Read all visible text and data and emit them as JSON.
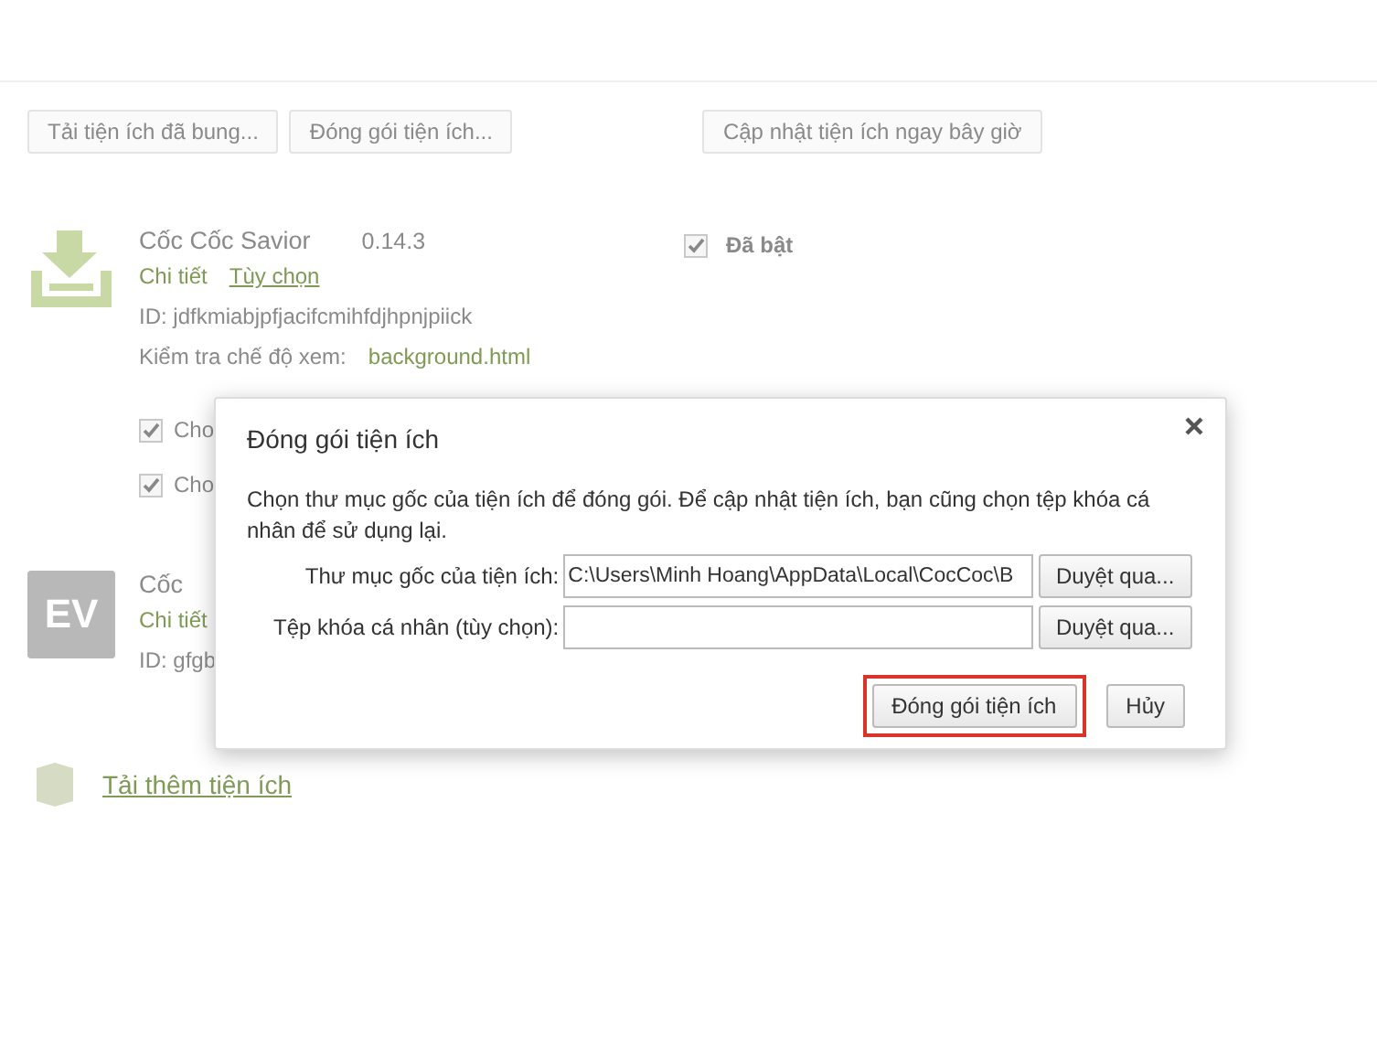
{
  "toolbar": {
    "buttons": [
      {
        "label": "Tải tiện ích đã bung..."
      },
      {
        "label": "Đóng gói tiện ích..."
      }
    ],
    "update_button": "Cập nhật tiện ích ngay bây giờ"
  },
  "extensions": [
    {
      "kind": "download",
      "name": "Cốc Cốc Savior",
      "version": "0.14.3",
      "links": [
        "Chi tiết",
        "Tùy chọn"
      ],
      "id": "ID: jdfkmiabjpfjacifcmihfdjhpnjpiick",
      "view_label": "Kiểm tra chế độ xem:",
      "view_link": "background.html",
      "enabled": {
        "label": "Đã bật",
        "checked": true
      },
      "options": [
        {
          "label": "Cho",
          "checked": true
        },
        {
          "label": "Cho",
          "checked": true
        }
      ]
    },
    {
      "kind": "ev",
      "logo": "EV",
      "name": "Cốc",
      "links": [
        "Chi tiết"
      ],
      "id": "ID: gfgb"
    }
  ],
  "get_more_link": "Tải thêm tiện ích",
  "dialog": {
    "title": "Đóng gói tiện ích",
    "description": "Chọn thư mục gốc của tiện ích để đóng gói. Để cập nhật tiện ích, bạn cũng chọn tệp khóa cá nhân để sử dụng lại.",
    "fields": [
      {
        "label": "Thư mục gốc của tiện ích:",
        "value": "C:\\Users\\Minh Hoang\\AppData\\Local\\CocCoc\\B",
        "browse": "Duyệt qua..."
      },
      {
        "label": "Tệp khóa cá nhân (tùy chọn):",
        "browse": "Duyệt qua..."
      }
    ],
    "buttons": [
      {
        "label": "Đóng gói tiện ích",
        "highlighted": true
      },
      {
        "label": "Hủy",
        "highlighted": false
      }
    ]
  }
}
